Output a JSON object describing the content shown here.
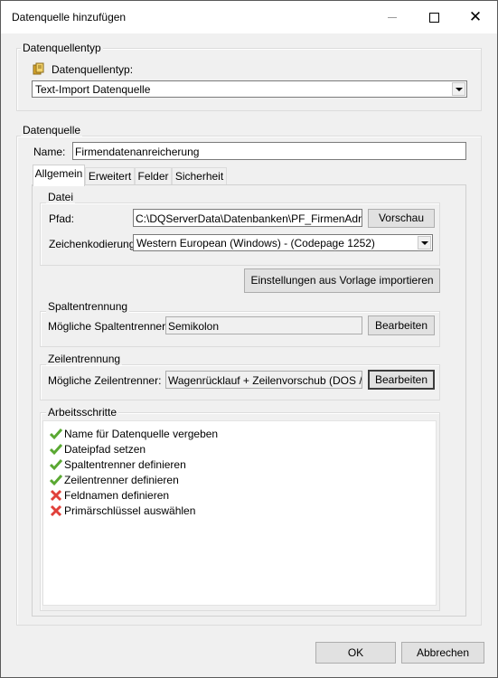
{
  "window": {
    "title": "Datenquelle hinzufügen"
  },
  "source_type_group": {
    "legend": "Datenquellentyp",
    "label": "Datenquellentyp:",
    "selected": "Text-Import Datenquelle"
  },
  "datasource_group": {
    "legend": "Datenquelle",
    "name_label": "Name:",
    "name_value": "Firmendatenanreicherung"
  },
  "tabs": [
    {
      "label": "Allgemein",
      "active": true
    },
    {
      "label": "Erweitert",
      "active": false
    },
    {
      "label": "Felder",
      "active": false
    },
    {
      "label": "Sicherheit",
      "active": false
    }
  ],
  "file_group": {
    "legend": "Datei",
    "path_label": "Pfad:",
    "path_value": "C:\\DQServerData\\Datenbanken\\PF_FirmenAdressen",
    "preview_button": "Vorschau",
    "encoding_label": "Zeichenkodierung:",
    "encoding_value": "Western European (Windows) - (Codepage 1252)"
  },
  "import_button": "Einstellungen aus Vorlage importieren",
  "column_group": {
    "legend": "Spaltentrennung",
    "label": "Mögliche Spaltentrenner:",
    "value": "Semikolon",
    "edit_button": "Bearbeiten"
  },
  "row_group": {
    "legend": "Zeilentrennung",
    "label": "Mögliche Zeilentrenner:",
    "value": "Wagenrücklauf + Zeilenvorschub (DOS / Windows)",
    "edit_button": "Bearbeiten"
  },
  "steps_group": {
    "legend": "Arbeitsschritte",
    "items": [
      {
        "text": "Name für Datenquelle vergeben",
        "icon": "check-icon",
        "done": true
      },
      {
        "text": "Dateipfad setzen",
        "icon": "check-icon",
        "done": true
      },
      {
        "text": "Spaltentrenner definieren",
        "icon": "check-icon",
        "done": true
      },
      {
        "text": "Zeilentrenner definieren",
        "icon": "check-icon",
        "done": true
      },
      {
        "text": "Feldnamen definieren",
        "icon": "cross-icon",
        "done": false
      },
      {
        "text": "Primärschlüssel auswählen",
        "icon": "cross-icon",
        "done": false
      }
    ]
  },
  "footer": {
    "ok_button": "OK",
    "cancel_button": "Abbrechen"
  },
  "colors": {
    "check": "#5aa832",
    "cross": "#e0403a",
    "window_bg": "#f0f0f0"
  }
}
